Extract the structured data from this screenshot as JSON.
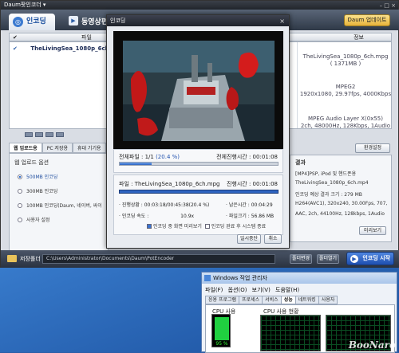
{
  "app": {
    "title": "Daum팟인코더 ▾",
    "window_controls": "– □ ×"
  },
  "header": {
    "tab_encoding": "인코딩",
    "tab_download": "동영상편",
    "update_button": "Daum 업데이트"
  },
  "file_list": {
    "header_check": "✔",
    "col_file": "파일",
    "col_info": "정보",
    "rows": [
      {
        "checked": "✔",
        "name": "TheLivingSea_1080p_6ch.mp"
      }
    ],
    "info": {
      "file_name": "TheLivingSea_1080p_6ch.mpg",
      "file_size": "( 1371MB )",
      "video_codec": "MPEG2",
      "video_spec": "1920x1080, 29.97fps, 4000Kbps",
      "audio_codec": "MPEG Audio Layer X(0x55)",
      "audio_spec": "2ch, 48000Hz, 128Kbps, 1Audio"
    }
  },
  "options": {
    "tabs": [
      "웹 업로드용",
      "PC 저장용",
      "휴대 기기용"
    ],
    "title": "웹 업로드 옵션",
    "items": [
      {
        "label": "500MB 인코딩",
        "selected": true
      },
      {
        "label": "300MB 인코딩",
        "selected": false
      },
      {
        "label": "100MB 인코딩(Daum, 네이버, 싸이",
        "selected": false
      },
      {
        "label": "사용자 설정",
        "selected": false
      }
    ]
  },
  "results": {
    "env_button": "환경설정",
    "title": "결과",
    "lines": [
      "[MP4]PSP, iPod 및 핸드폰용",
      "TheLivingSea_1080p_6ch.mp4",
      "인코딩 예상 결과 크기 : 279 MB",
      "H264(AVC1), 320x240, 30.00Fps, 707,",
      "AAC, 2ch, 44100Hz, 128kbps, 1Audio"
    ],
    "more_button": "미리보기"
  },
  "bottom": {
    "save_folder_label": "저장폴더",
    "save_path": "C:\\Users\\Administrator\\Documents\\Daum\\PotEncoder",
    "change_button": "폴더변경",
    "open_button": "폴더열기",
    "start_button": "인코딩 시작"
  },
  "dialog": {
    "title": "인코딩",
    "close": "×",
    "overall_label": "전체파일 : 1/1",
    "overall_pct": "(20.4 %)",
    "overall_progress": 0.204,
    "overall_time_label": "전체진행시간 : ",
    "overall_time": "00:01:08",
    "file_label": "파일 : TheLivingSea_1080p_6ch.mpg",
    "file_time_label": "진행시간 : ",
    "file_time": "00:01:08",
    "stat_progress_label": "· 진행상황 : ",
    "stat_progress": "00:03:18/00:45:38(20.4 %)",
    "stat_remain_label": "· 남은시간 : ",
    "stat_remain": "00:04:29",
    "stat_speed_label": "· 인코딩 속도 : ",
    "stat_speed": "10.9x",
    "stat_size_label": "· 파일크기 : ",
    "stat_size": "56.86 MB",
    "opt_preview": "인코딩 중 화면 미리보기",
    "opt_shutdown": "인코딩 완료 후 시스템 종료",
    "pause_button": "일시중단",
    "cancel_button": "취소"
  },
  "task_manager": {
    "title": "Windows 작업 관리자",
    "menu": "파일(F)  옵션(O)  보기(V)  도움말(H)",
    "tabs": [
      "응용 프로그램",
      "프로세스",
      "서비스",
      "성능",
      "네트워킹",
      "사용자"
    ],
    "active_tab": "성능",
    "cpu_usage_label": "CPU 사용",
    "cpu_history_label": "CPU 사용 현황",
    "cpu_pct": "95 %",
    "cpu_value": 0.95
  },
  "watermark": "BooNaro"
}
